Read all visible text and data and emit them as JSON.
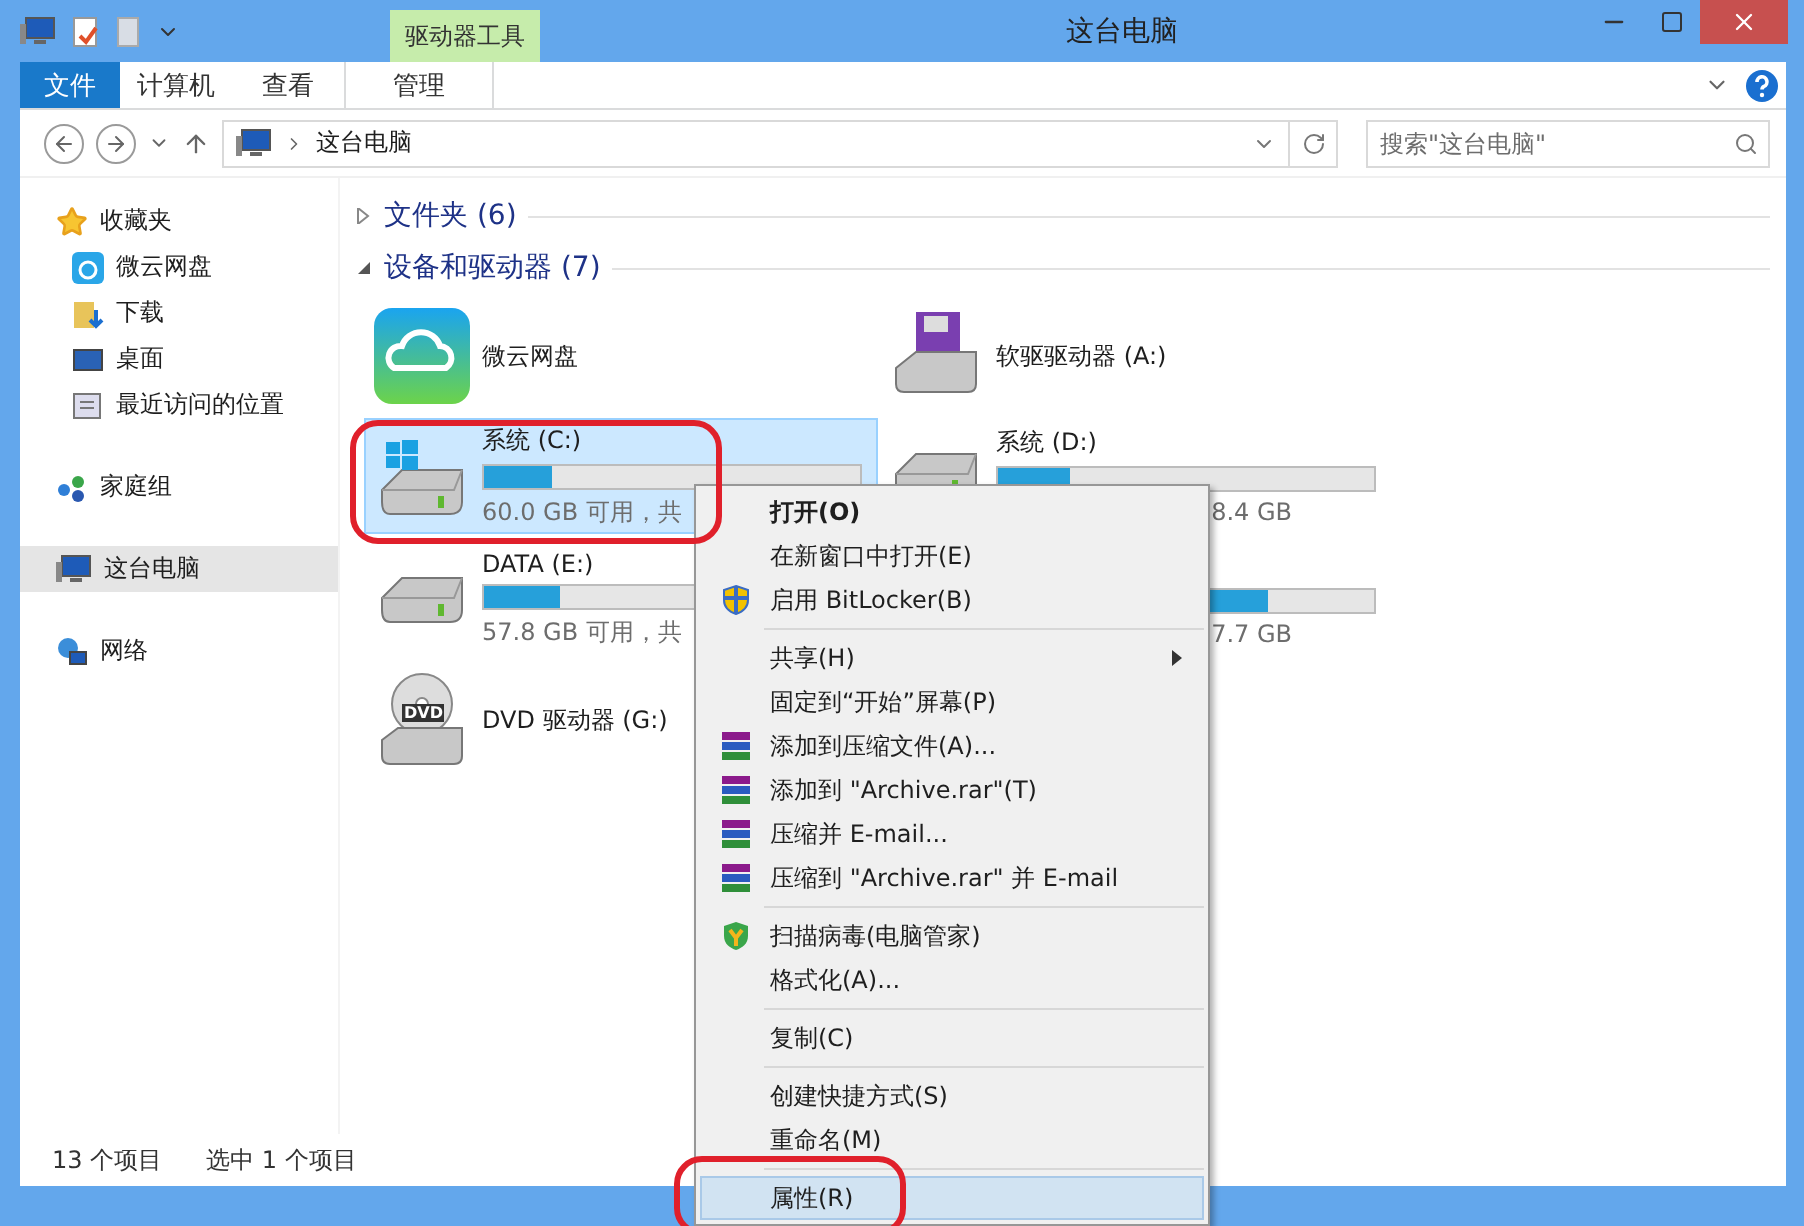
{
  "window": {
    "title": "这台电脑"
  },
  "ribbon": {
    "context_tab": "驱动器工具",
    "tabs": [
      {
        "label": "文件",
        "selected": true,
        "kind": "file"
      },
      {
        "label": "计算机",
        "selected": false,
        "kind": "normal"
      },
      {
        "label": "查看",
        "selected": false,
        "kind": "normal"
      },
      {
        "label": "管理",
        "selected": false,
        "kind": "context"
      }
    ]
  },
  "address": {
    "path": "这台电脑",
    "search_placeholder": "搜索\"这台电脑\""
  },
  "sidebar": {
    "items": [
      {
        "label": "收藏夹",
        "kind": "favorites",
        "selected": false,
        "children": [
          {
            "label": "微云网盘",
            "kind": "cloud",
            "selected": false
          },
          {
            "label": "下载",
            "kind": "downloads",
            "selected": false
          },
          {
            "label": "桌面",
            "kind": "desktop",
            "selected": false
          },
          {
            "label": "最近访问的位置",
            "kind": "recent",
            "selected": false
          }
        ]
      },
      {
        "label": "家庭组",
        "kind": "homegroup",
        "selected": false
      },
      {
        "label": "这台电脑",
        "kind": "pc",
        "selected": true
      },
      {
        "label": "网络",
        "kind": "network",
        "selected": false
      }
    ]
  },
  "groups": [
    {
      "title": "文件夹 (6)",
      "expanded": false
    },
    {
      "title": "设备和驱动器 (7)",
      "expanded": true
    }
  ],
  "drives": [
    {
      "kind": "cloud",
      "name": "微云网盘",
      "selected": false
    },
    {
      "kind": "floppy",
      "name": "软驱驱动器 (A:)",
      "selected": false
    },
    {
      "kind": "system",
      "name": "系统 (C:)",
      "level": 0.18,
      "free": "60.0 GB 可用，共",
      "selected": true
    },
    {
      "kind": "disk",
      "name": "系统 (D:)",
      "level": 0.19,
      "free": "8.4 GB",
      "selected": false
    },
    {
      "kind": "disk",
      "name": "DATA (E:)",
      "level": 0.2,
      "free": "57.8 GB 可用，共",
      "selected": false
    },
    {
      "kind": "disk",
      "level": 0.72,
      "free": "7.7 GB",
      "selected": false
    },
    {
      "kind": "dvd",
      "name": "DVD 驱动器 (G:)",
      "badge": "DVD",
      "selected": false
    }
  ],
  "context_menu": [
    {
      "kind": "item",
      "label": "打开(O)",
      "default": true,
      "selected": false
    },
    {
      "kind": "item",
      "label": "在新窗口中打开(E)",
      "selected": false
    },
    {
      "kind": "bitlocker",
      "label": "启用 BitLocker(B)",
      "selected": false
    },
    {
      "kind": "separator"
    },
    {
      "kind": "item",
      "label": "共享(H)",
      "submenu": true,
      "selected": false
    },
    {
      "kind": "item",
      "label": "固定到“开始”屏幕(P)",
      "selected": false
    },
    {
      "kind": "archive",
      "label": "添加到压缩文件(A)...",
      "selected": false
    },
    {
      "kind": "archive",
      "label": "添加到 \"Archive.rar\"(T)",
      "selected": false
    },
    {
      "kind": "archive",
      "label": "压缩并 E-mail...",
      "selected": false
    },
    {
      "kind": "archive",
      "label": "压缩到 \"Archive.rar\" 并 E-mail",
      "selected": false
    },
    {
      "kind": "separator"
    },
    {
      "kind": "antivirus",
      "label": "扫描病毒(电脑管家)",
      "selected": false
    },
    {
      "kind": "item",
      "label": "格式化(A)...",
      "selected": false
    },
    {
      "kind": "separator"
    },
    {
      "kind": "item",
      "label": "复制(C)",
      "selected": false
    },
    {
      "kind": "separator"
    },
    {
      "kind": "item",
      "label": "创建快捷方式(S)",
      "selected": false
    },
    {
      "kind": "item",
      "label": "重命名(M)",
      "selected": false
    },
    {
      "kind": "separator"
    },
    {
      "kind": "item",
      "label": "属性(R)",
      "selected": true
    }
  ],
  "status_bar": {
    "count": "13 个项目",
    "selection": "选中 1 个项目"
  }
}
